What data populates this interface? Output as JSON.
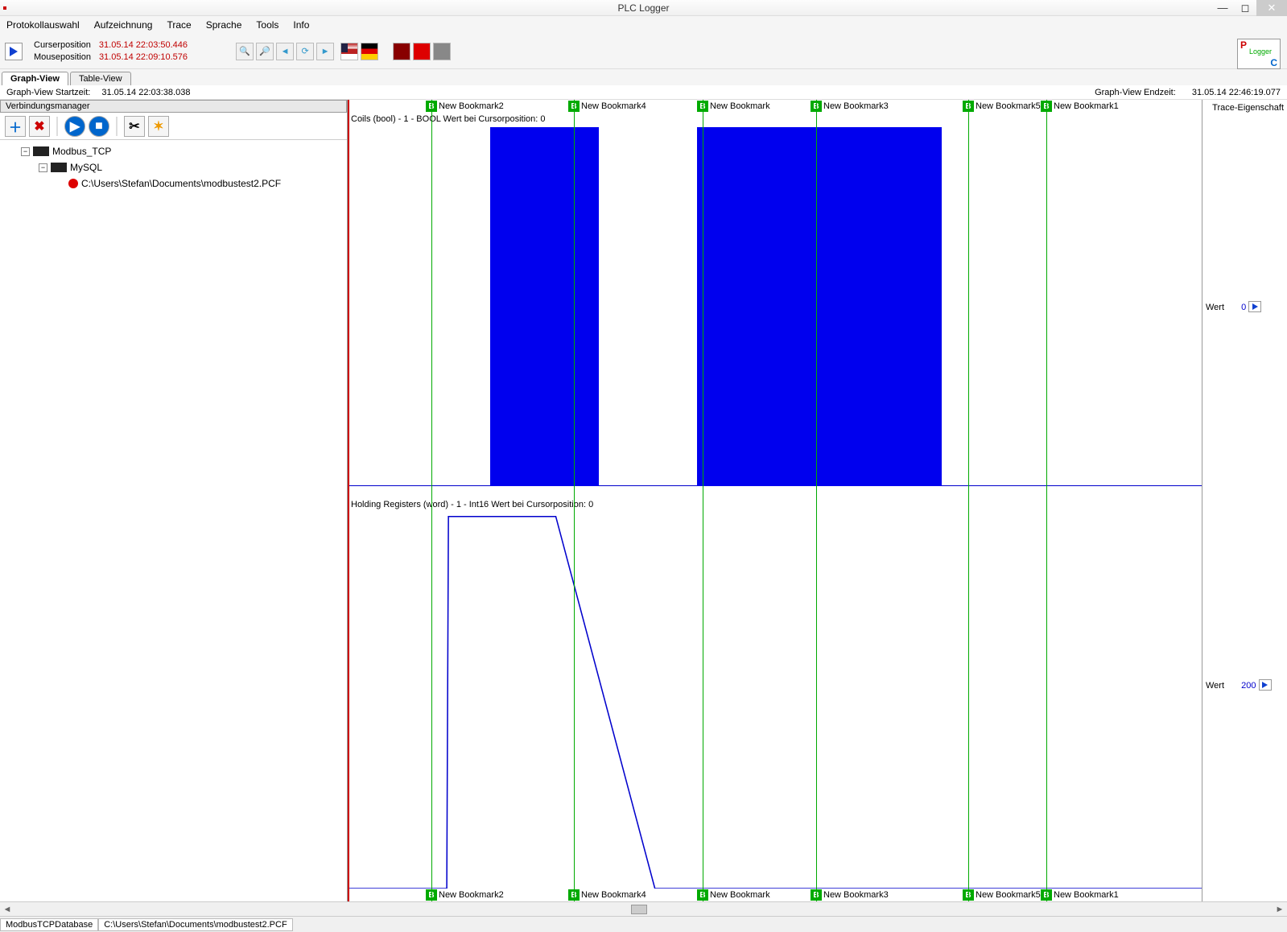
{
  "title": "PLC Logger",
  "menu": [
    "Protokollauswahl",
    "Aufzeichnung",
    "Trace",
    "Sprache",
    "Tools",
    "Info"
  ],
  "toolbar": {
    "cursor_label": "Curserposition",
    "cursor_value": "31.05.14 22:03:50.446",
    "mouse_label": "Mouseposition",
    "mouse_value": "31.05.14 22:09:10.576"
  },
  "tabs": {
    "graph": "Graph-View",
    "table": "Table-View"
  },
  "timebar": {
    "start_label": "Graph-View Startzeit:",
    "start_value": "31.05.14 22:03:38.038",
    "end_label": "Graph-View Endzeit:",
    "end_value": "31.05.14 22:46:19.077"
  },
  "sidebar": {
    "title": "Verbindungsmanager",
    "tree": {
      "n1": "Modbus_TCP",
      "n2": "MySQL",
      "n3": "C:\\Users\\Stefan\\Documents\\modbustest2.PCF"
    }
  },
  "plot_right": {
    "header": "Trace-Eigenschaft",
    "wert_label": "Wert",
    "wert1": "0",
    "wert2": "200"
  },
  "bookmarks": [
    {
      "label": "New Bookmark2",
      "x": 95
    },
    {
      "label": "New Bookmark4",
      "x": 272
    },
    {
      "label": "New Bookmark",
      "x": 432
    },
    {
      "label": "New Bookmark3",
      "x": 573
    },
    {
      "label": "New Bookmark5",
      "x": 762
    },
    {
      "label": "New Bookmark1",
      "x": 859
    }
  ],
  "charts": {
    "chart1_label": "Coils (bool) - 1 - BOOL Wert bei Cursorposition: 0",
    "chart2_label": "Holding Registers (word) - 1 - Int16 Wert bei Cursorposition: 0"
  },
  "status": {
    "left": "ModbusTCPDatabase",
    "right": "C:\\Users\\Stefan\\Documents\\modbustest2.PCF"
  },
  "chart_data": [
    {
      "type": "area",
      "title": "Coils (bool) - 1 - BOOL",
      "x_range": [
        0,
        1032
      ],
      "ylim": [
        0,
        1
      ],
      "segments_high": [
        [
          175,
          310
        ],
        [
          432,
          736
        ]
      ]
    },
    {
      "type": "line",
      "title": "Holding Registers (word) - 1 - Int16",
      "x_range": [
        0,
        1032
      ],
      "points": [
        [
          0,
          0
        ],
        [
          118,
          0
        ],
        [
          120,
          430
        ],
        [
          250,
          430
        ],
        [
          370,
          0
        ],
        [
          1032,
          0
        ]
      ]
    }
  ]
}
